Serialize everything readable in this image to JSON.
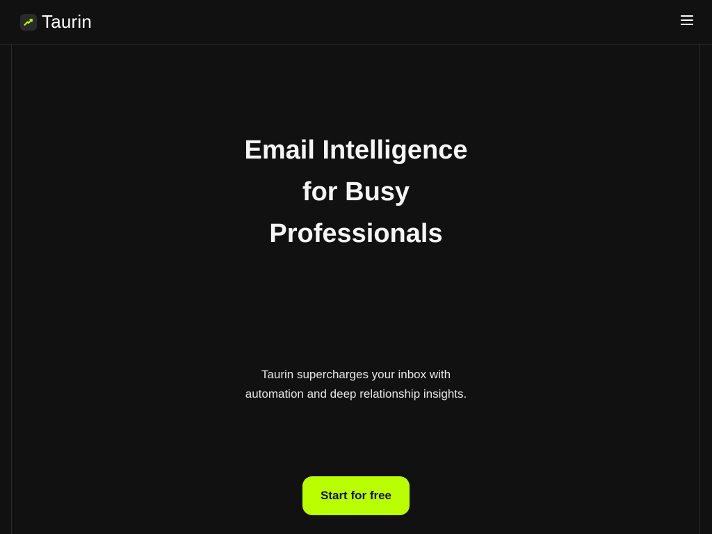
{
  "navbar": {
    "brand_name": "Taurin",
    "logo_icon": "lightning-bolt-icon",
    "menu_icon": "hamburger-menu-icon"
  },
  "hero": {
    "title_lines": [
      "Email Intelligence",
      "for Busy",
      "Professionals"
    ],
    "subtitle_lines": [
      "Taurin supercharges your inbox with",
      "automation and deep relationship insights."
    ],
    "cta_label": "Start for free"
  },
  "colors": {
    "background": "#121112",
    "accent": "#b9ff00",
    "text": "#ffffff",
    "border": "#2b2b2b"
  }
}
